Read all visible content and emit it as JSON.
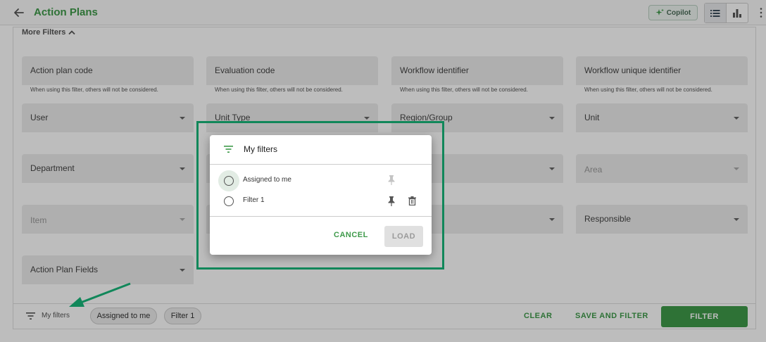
{
  "header": {
    "title": "Action Plans",
    "copilot_label": "Copilot",
    "back_icon": "arrow-left-icon",
    "list_view_icon": "list-icon",
    "chart_view_icon": "bar-chart-icon",
    "menu_icon": "more-vertical-icon"
  },
  "filters": {
    "more_filters_label": "More Filters",
    "hint": "When using this filter, others will not be considered.",
    "fields": [
      {
        "label": "Action plan code",
        "type": "text",
        "hint": true
      },
      {
        "label": "Evaluation code",
        "type": "text",
        "hint": true
      },
      {
        "label": "Workflow identifier",
        "type": "text",
        "hint": true
      },
      {
        "label": "Workflow unique identifier",
        "type": "text",
        "hint": true
      },
      {
        "label": "User",
        "type": "select"
      },
      {
        "label": "Unit Type",
        "type": "select"
      },
      {
        "label": "Region/Group",
        "type": "select"
      },
      {
        "label": "Unit",
        "type": "select"
      },
      {
        "label": "Department",
        "type": "select"
      },
      {
        "label": "Area",
        "type": "select",
        "disabled": true
      },
      {
        "label": "Item",
        "type": "select",
        "disabled": true
      },
      {
        "label": "Responsible",
        "type": "select"
      },
      {
        "label": "Action Plan Fields",
        "type": "select"
      }
    ]
  },
  "bottom_bar": {
    "my_filters_label": "My filters",
    "chips": [
      "Assigned to me",
      "Filter 1"
    ],
    "clear_label": "CLEAR",
    "save_and_filter_label": "SAVE AND FILTER",
    "filter_label": "FILTER"
  },
  "dialog": {
    "title": "My filters",
    "items": [
      {
        "label": "Assigned to me",
        "pinned": false,
        "deletable": false
      },
      {
        "label": "Filter 1",
        "pinned": true,
        "deletable": true
      }
    ],
    "cancel_label": "CANCEL",
    "load_label": "LOAD"
  },
  "colors": {
    "brand_green": "#3e9a4a",
    "highlight_frame": "#11875a",
    "annotation_arrow": "#11875a"
  }
}
